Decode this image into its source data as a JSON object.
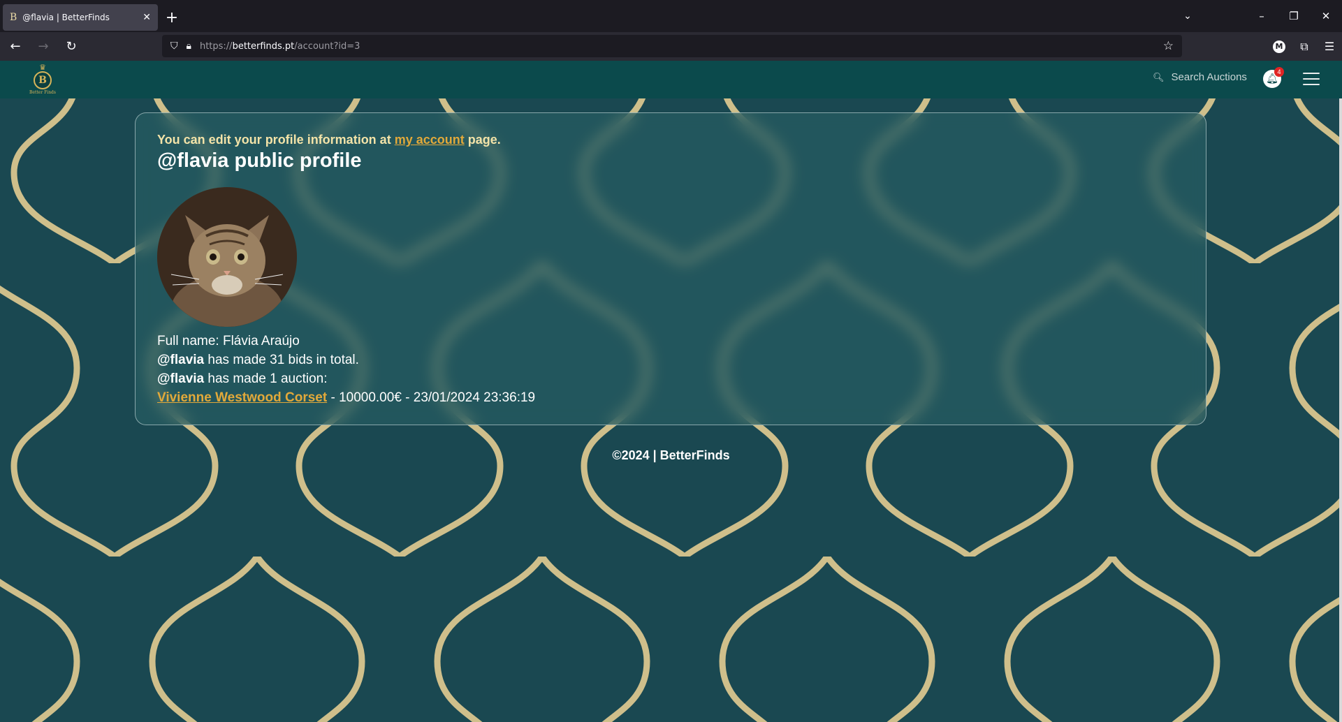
{
  "browser": {
    "tab_title": "@flavia | BetterFinds",
    "tab_favicon": "B",
    "new_tab": "+",
    "url_prefix": "https://",
    "url_host": "betterfinds.pt",
    "url_path": "/account?id=3",
    "extension_initial": "M"
  },
  "site": {
    "logo_text": "Better Finds",
    "logo_initial": "B",
    "search_label": "Search Auctions",
    "notification_count": "4"
  },
  "profile": {
    "edit_note_prefix": "You can edit your profile information at ",
    "edit_note_link": "my account",
    "edit_note_suffix": " page.",
    "title": "@flavia public profile",
    "full_name_label": "Full name: ",
    "full_name": "Flávia Araújo",
    "username": "@flavia",
    "bids_text": " has made 31 bids in total.",
    "auctions_text": " has made 1 auction:",
    "auction_link": "Vivienne Westwood Corset",
    "auction_details": " - 10000.00€ - 23/01/2024 23:36:19"
  },
  "footer": {
    "text": "©2024 | BetterFinds"
  },
  "colors": {
    "header_bg": "#0b4a4c",
    "accent_gold": "#e2a93a",
    "note_cream": "#f3e3a8",
    "pattern_gold": "#d9c58e",
    "background_teal": "#1d4e57",
    "badge_red": "#e02424"
  }
}
